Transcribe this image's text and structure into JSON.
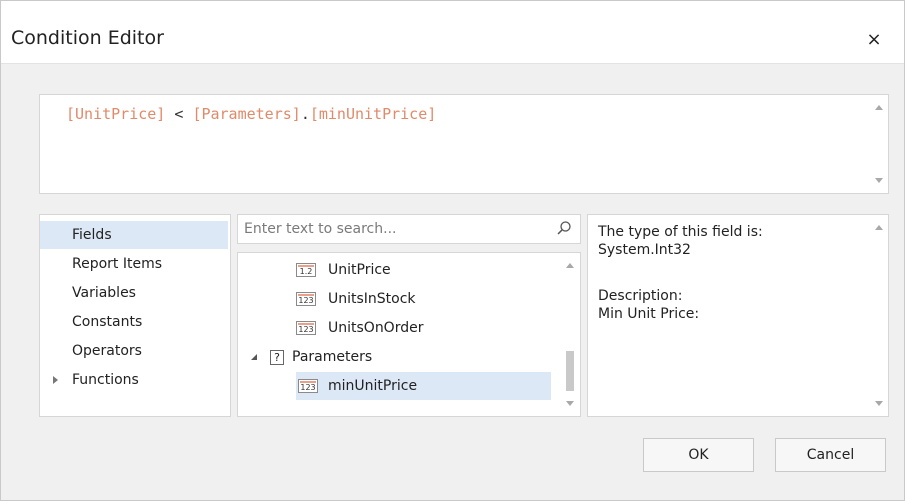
{
  "window": {
    "title": "Condition Editor",
    "close_glyph": "×"
  },
  "expression": {
    "part1": "[UnitPrice]",
    "operator": " < ",
    "part2": "[Parameters]",
    "dot": ".",
    "part3": "[minUnitPrice]"
  },
  "categories": {
    "items": [
      {
        "label": "Fields"
      },
      {
        "label": "Report Items"
      },
      {
        "label": "Variables"
      },
      {
        "label": "Constants"
      },
      {
        "label": "Operators"
      },
      {
        "label": "Functions"
      }
    ]
  },
  "search": {
    "placeholder": "Enter text to search..."
  },
  "tree": {
    "rows": [
      {
        "label": "UnitPrice",
        "type_badge": "1.2"
      },
      {
        "label": "UnitsInStock",
        "type_badge": "123"
      },
      {
        "label": "UnitsOnOrder",
        "type_badge": "123"
      },
      {
        "label": "Parameters",
        "type_badge": "?"
      },
      {
        "label": "minUnitPrice",
        "type_badge": "123"
      }
    ]
  },
  "description": {
    "line1": "The type of this field is:",
    "line2": "System.Int32",
    "line3": "Description:",
    "line4": "Min Unit Price:"
  },
  "buttons": {
    "ok": "OK",
    "cancel": "Cancel"
  },
  "colors": {
    "selection": "#dde8f7",
    "expression_token": "#e08a6a"
  }
}
